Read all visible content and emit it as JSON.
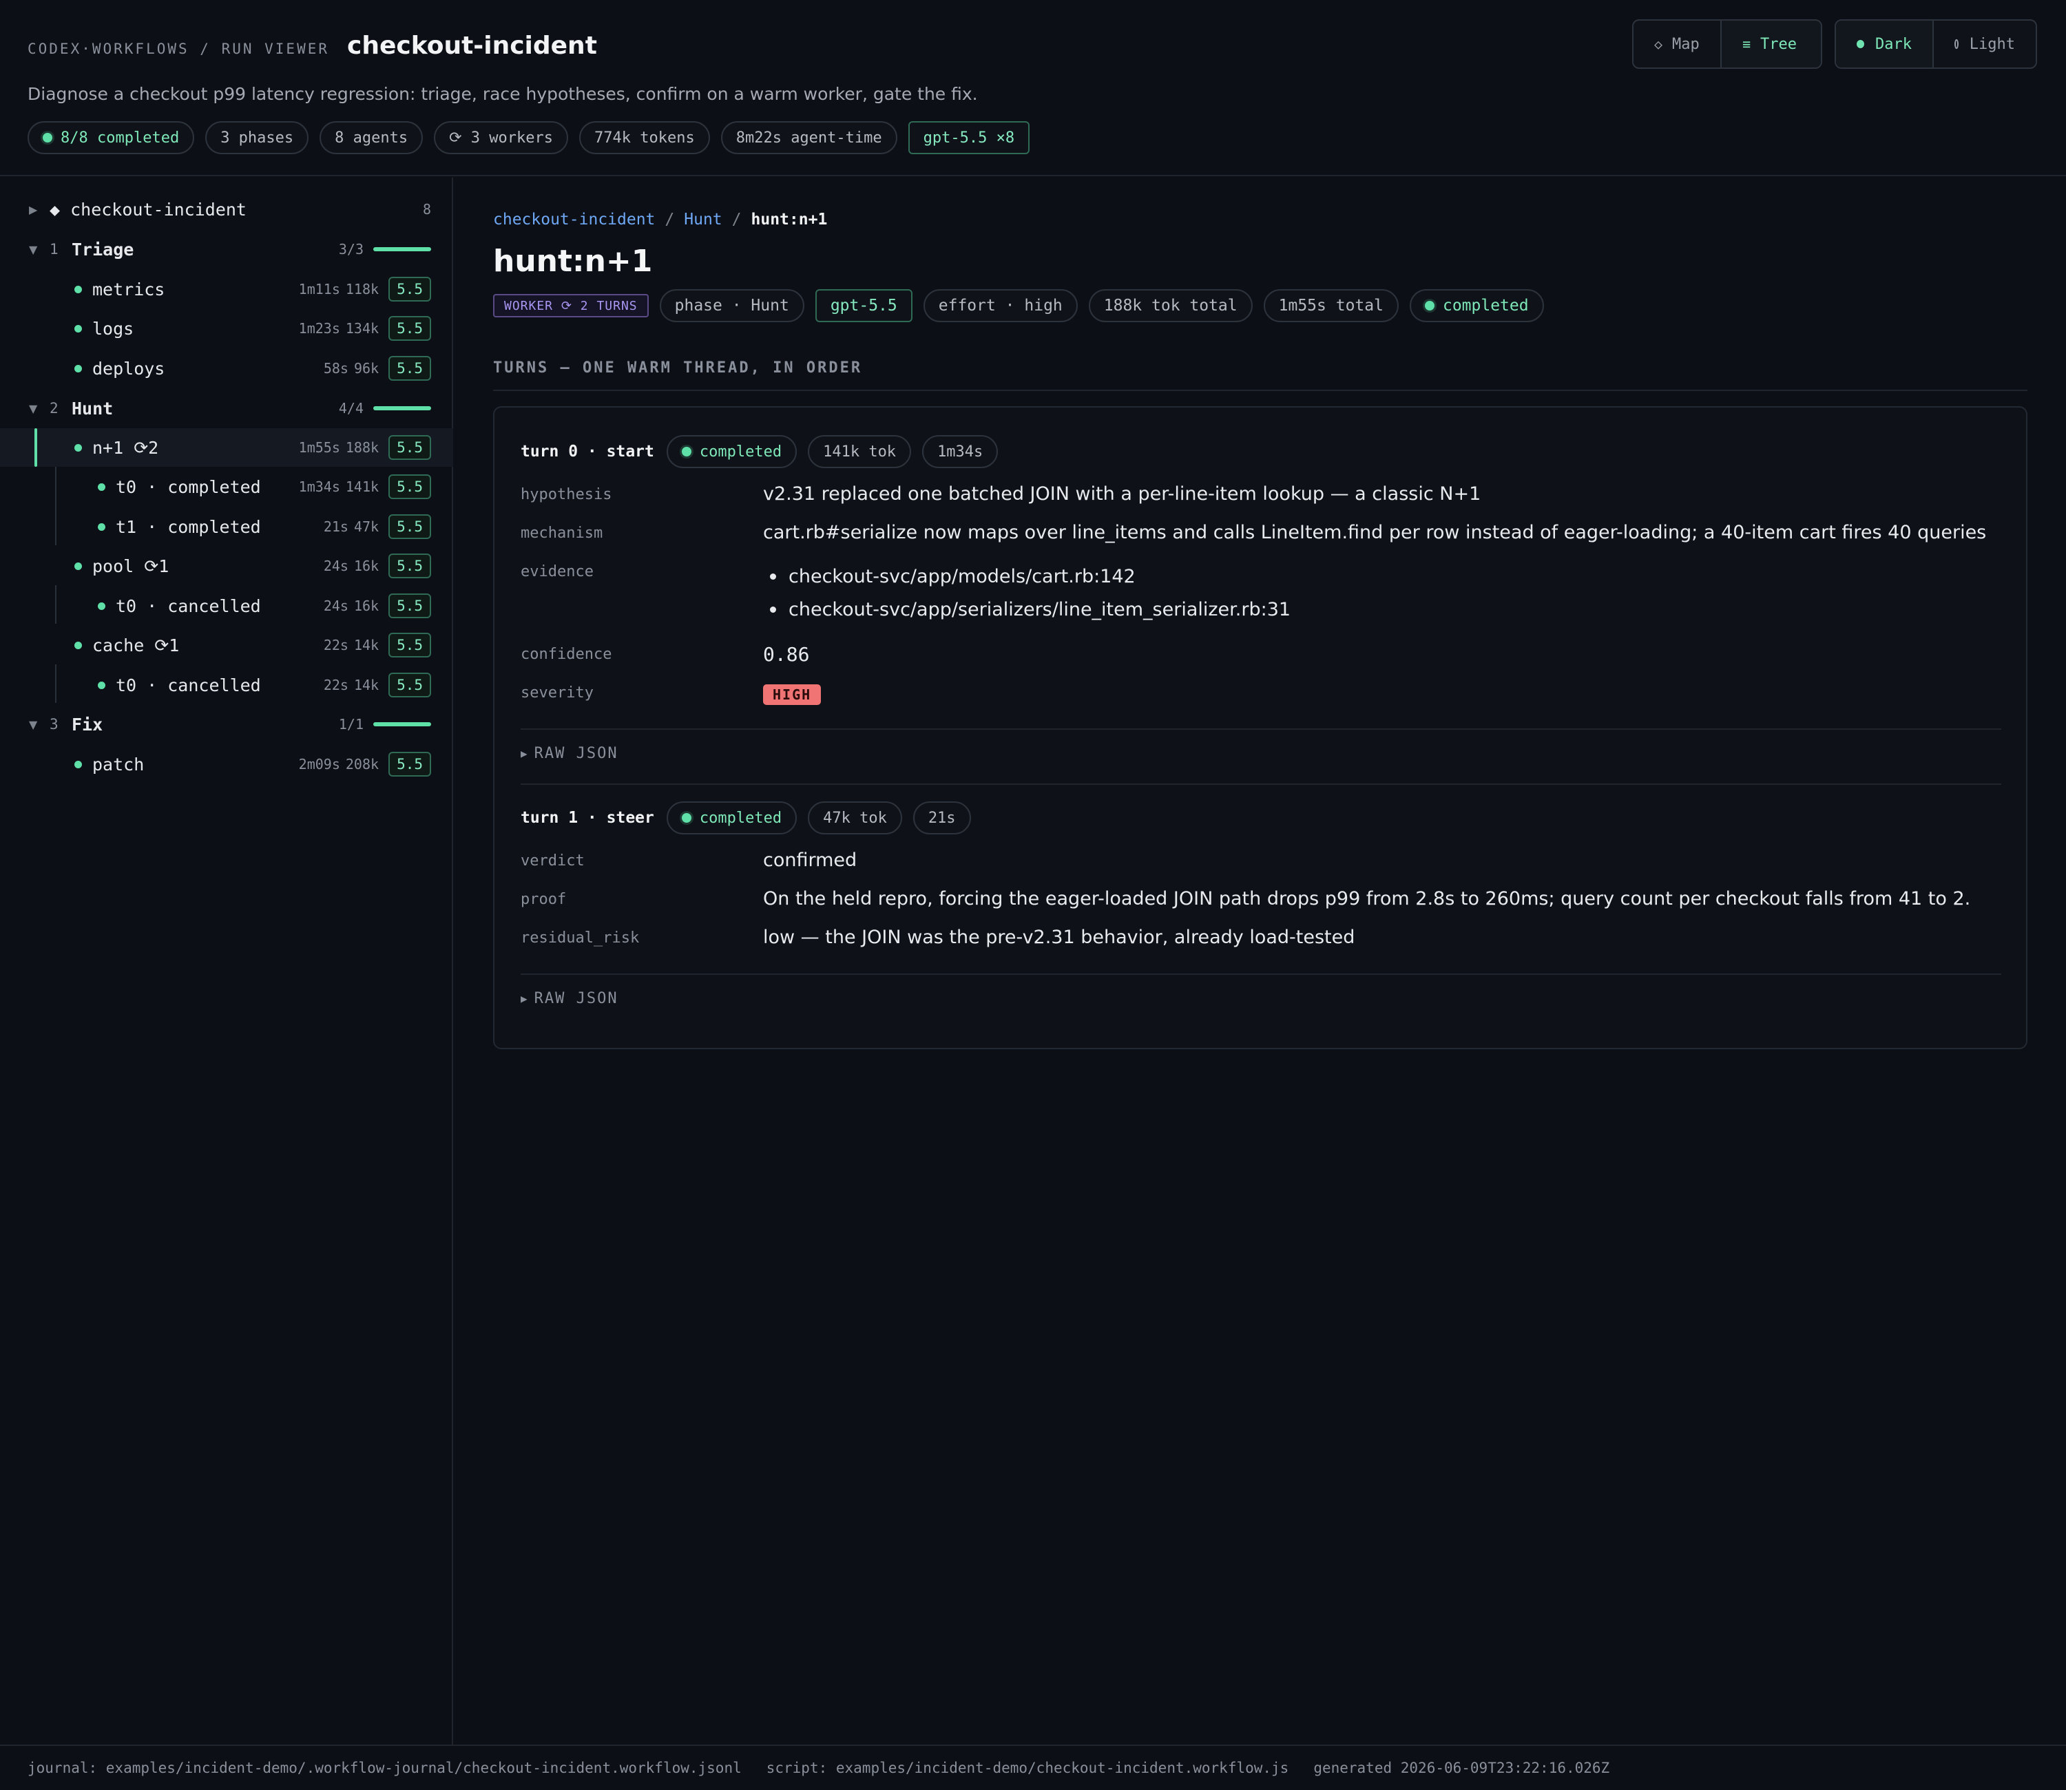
{
  "header": {
    "kicker": "CODEX·WORKFLOWS / RUN VIEWER",
    "title": "checkout-incident",
    "subtitle": "Diagnose a checkout p99 latency regression: triage, race hypotheses, confirm on a warm worker, gate the fix.",
    "chips": {
      "completed": "8/8 completed",
      "phases": "3 phases",
      "agents": "8 agents",
      "workers": "⟳ 3 workers",
      "tokens": "774k tokens",
      "agent_time": "8m22s agent-time",
      "model": "gpt-5.5 ×8"
    },
    "view_toggle": {
      "map": "Map",
      "tree": "Tree",
      "map_icon": "◇",
      "tree_icon": "≡",
      "selected": "Tree"
    },
    "theme_toggle": {
      "dark": "Dark",
      "light": "Light",
      "selected": "Dark"
    }
  },
  "sidebar": {
    "root": {
      "label": "◆ checkout-incident",
      "count": "8"
    },
    "phases": [
      {
        "num": "1",
        "name": "Triage",
        "progress": "3/3",
        "progress_fraction": 1.0,
        "agents": [
          {
            "label": "metrics",
            "time": "1m11s",
            "tokens": "118k",
            "model": "5.5"
          },
          {
            "label": "logs",
            "time": "1m23s",
            "tokens": "134k",
            "model": "5.5"
          },
          {
            "label": "deploys",
            "time": "58s",
            "tokens": "96k",
            "model": "5.5"
          }
        ]
      },
      {
        "num": "2",
        "name": "Hunt",
        "progress": "4/4",
        "progress_fraction": 1.0,
        "agents": [
          {
            "label": "n+1 ⟳2",
            "time": "1m55s",
            "tokens": "188k",
            "model": "5.5",
            "selected": true,
            "turns": [
              {
                "label": "t0 · completed",
                "time": "1m34s",
                "tokens": "141k",
                "model": "5.5"
              },
              {
                "label": "t1 · completed",
                "time": "21s",
                "tokens": "47k",
                "model": "5.5"
              }
            ]
          },
          {
            "label": "pool ⟳1",
            "time": "24s",
            "tokens": "16k",
            "model": "5.5",
            "turns": [
              {
                "label": "t0 · cancelled",
                "time": "24s",
                "tokens": "16k",
                "model": "5.5"
              }
            ]
          },
          {
            "label": "cache ⟳1",
            "time": "22s",
            "tokens": "14k",
            "model": "5.5",
            "turns": [
              {
                "label": "t0 · cancelled",
                "time": "22s",
                "tokens": "14k",
                "model": "5.5"
              }
            ]
          }
        ]
      },
      {
        "num": "3",
        "name": "Fix",
        "progress": "1/1",
        "progress_fraction": 1.0,
        "agents": [
          {
            "label": "patch",
            "time": "2m09s",
            "tokens": "208k",
            "model": "5.5"
          }
        ]
      }
    ]
  },
  "main": {
    "breadcrumb": {
      "root": "checkout-incident",
      "phase": "Hunt",
      "current": "hunt:n+1",
      "sep": "/"
    },
    "title": "hunt:n+1",
    "chips": {
      "worker": "WORKER ⟳ 2 TURNS",
      "phase": "phase · Hunt",
      "model": "gpt-5.5",
      "effort": "effort · high",
      "tokens": "188k tok total",
      "time": "1m55s total",
      "status": "completed"
    },
    "section_title": "TURNS — ONE WARM THREAD, IN ORDER",
    "turns": [
      {
        "title": "turn 0 · start",
        "status": "completed",
        "tokens": "141k tok",
        "time": "1m34s",
        "fields": {
          "hypothesis_k": "hypothesis",
          "hypothesis_v": "v2.31 replaced one batched JOIN with a per-line-item lookup — a classic N+1",
          "mechanism_k": "mechanism",
          "mechanism_v": "cart.rb#serialize now maps over line_items and calls LineItem.find per row instead of eager-loading; a 40-item cart fires 40 queries",
          "evidence_k": "evidence",
          "evidence": [
            "checkout-svc/app/models/cart.rb:142",
            "checkout-svc/app/serializers/line_item_serializer.rb:31"
          ],
          "confidence_k": "confidence",
          "confidence_v": "0.86",
          "severity_k": "severity",
          "severity_v": "HIGH"
        },
        "raw": "RAW JSON"
      },
      {
        "title": "turn 1 · steer",
        "status": "completed",
        "tokens": "47k tok",
        "time": "21s",
        "fields": {
          "verdict_k": "verdict",
          "verdict_v": "confirmed",
          "proof_k": "proof",
          "proof_v": "On the held repro, forcing the eager-loaded JOIN path drops p99 from 2.8s to 260ms; query count per checkout falls from 41 to 2.",
          "residual_k": "residual_risk",
          "residual_v": "low — the JOIN was the pre-v2.31 behavior, already load-tested"
        },
        "raw": "RAW JSON"
      }
    ]
  },
  "footer": {
    "journal": "journal: examples/incident-demo/.workflow-journal/checkout-incident.workflow.jsonl",
    "script": "script: examples/incident-demo/checkout-incident.workflow.js",
    "generated": "generated 2026-06-09T23:22:16.026Z"
  },
  "colors": {
    "accent": "#5fe0a8",
    "link": "#6fa8f5",
    "severity_high": "#f07474",
    "worker": "#a996f2"
  }
}
